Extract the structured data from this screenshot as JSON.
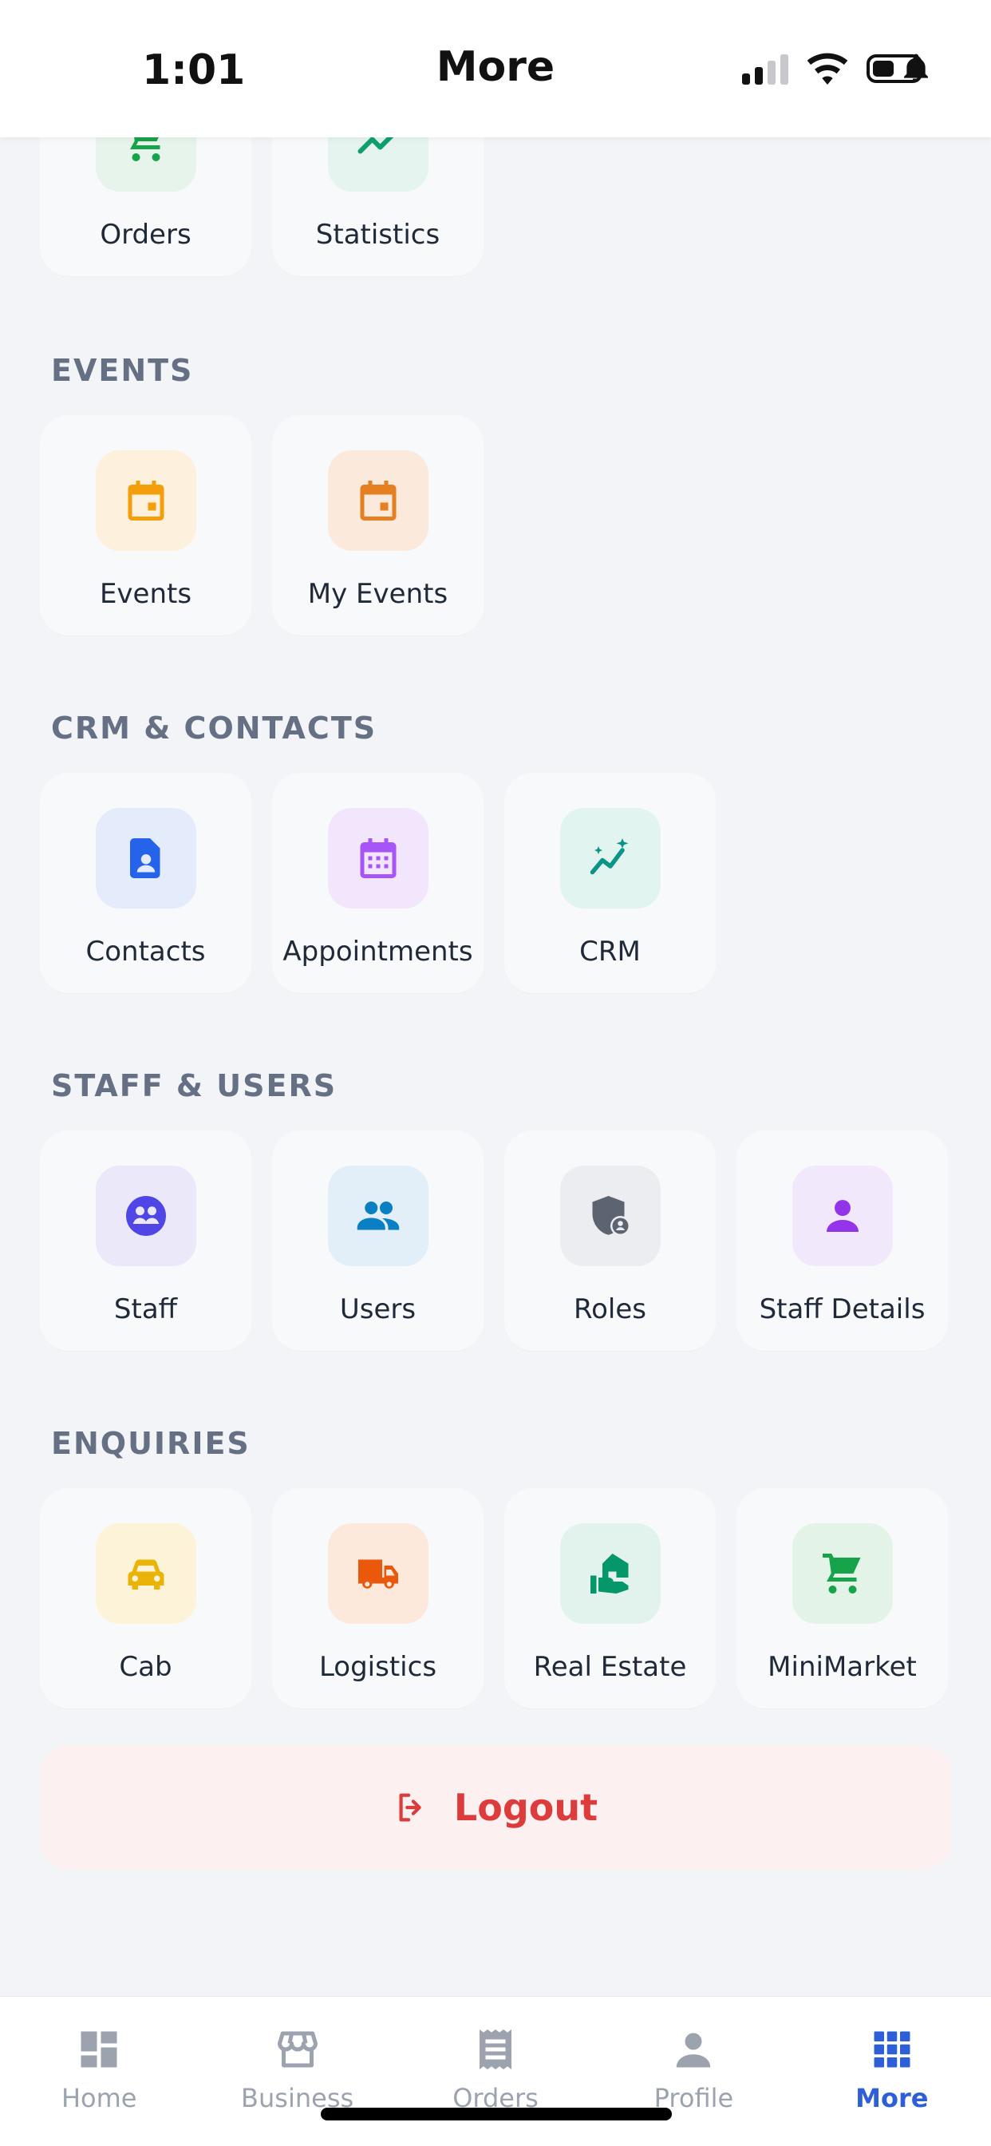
{
  "status_bar": {
    "time": "1:01"
  },
  "header": {
    "title": "More"
  },
  "sections": [
    {
      "title": "",
      "items": [
        {
          "label": "Orders",
          "icon": "cart-icon",
          "bg": "#e6f4ec",
          "color": "#16a34a"
        },
        {
          "label": "Statistics",
          "icon": "trend-icon",
          "bg": "#e6f4ef",
          "color": "#0f9f6e"
        }
      ]
    },
    {
      "title": "EVENTS",
      "items": [
        {
          "label": "Events",
          "icon": "calendar-icon",
          "bg": "#fdf0dc",
          "color": "#f59e0b"
        },
        {
          "label": "My Events",
          "icon": "calendar-icon",
          "bg": "#fbe9dc",
          "color": "#e67e22"
        }
      ]
    },
    {
      "title": "CRM & CONTACTS",
      "items": [
        {
          "label": "Contacts",
          "icon": "contact-file-icon",
          "bg": "#e4ebfb",
          "color": "#2563eb"
        },
        {
          "label": "Appointments",
          "icon": "calendar-grid-icon",
          "bg": "#f1e6fb",
          "color": "#a855f7"
        },
        {
          "label": "CRM",
          "icon": "sparkle-trend-icon",
          "bg": "#e2f4f0",
          "color": "#0d9488"
        }
      ]
    },
    {
      "title": "STAFF & USERS",
      "items": [
        {
          "label": "Staff",
          "icon": "group-circle-icon",
          "bg": "#ebe8fa",
          "color": "#4f46e5"
        },
        {
          "label": "Users",
          "icon": "people-icon",
          "bg": "#e2eef8",
          "color": "#0b7fc4"
        },
        {
          "label": "Roles",
          "icon": "shield-user-icon",
          "bg": "#ebedf0",
          "color": "#5b6470"
        },
        {
          "label": "Staff Details",
          "icon": "person-icon",
          "bg": "#f1e8fb",
          "color": "#9333ea"
        }
      ]
    },
    {
      "title": "ENQUIRIES",
      "items": [
        {
          "label": "Cab",
          "icon": "car-icon",
          "bg": "#fdf3d8",
          "color": "#eab308"
        },
        {
          "label": "Logistics",
          "icon": "truck-icon",
          "bg": "#fce9dc",
          "color": "#ea580c"
        },
        {
          "label": "Real Estate",
          "icon": "house-hand-icon",
          "bg": "#e2f2ec",
          "color": "#059669"
        },
        {
          "label": "MiniMarket",
          "icon": "cart-icon",
          "bg": "#e3f3e8",
          "color": "#16a34a"
        }
      ]
    }
  ],
  "logout": {
    "label": "Logout",
    "color": "#dc3c3c"
  },
  "bottom_nav": [
    {
      "label": "Home",
      "icon": "dashboard-icon",
      "active": false
    },
    {
      "label": "Business",
      "icon": "store-icon",
      "active": false
    },
    {
      "label": "Orders",
      "icon": "receipt-icon",
      "active": false
    },
    {
      "label": "Profile",
      "icon": "profile-icon",
      "active": false
    },
    {
      "label": "More",
      "icon": "grid-icon",
      "active": true
    }
  ],
  "colors": {
    "accent": "#2f5fd7",
    "inactive": "#9ca3af"
  }
}
